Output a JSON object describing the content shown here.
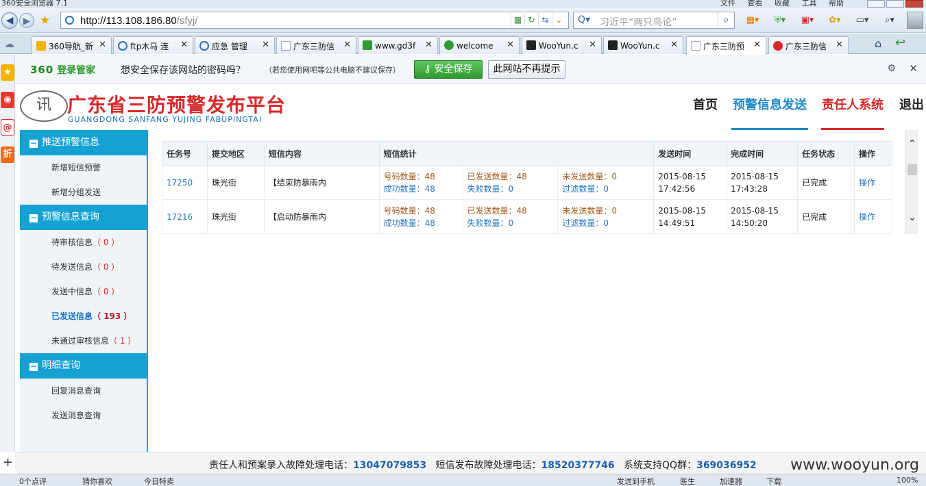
{
  "browser": {
    "title": "360安全浏览器 7.1",
    "menus": [
      "文件",
      "查看",
      "收藏",
      "工具",
      "帮助"
    ],
    "url_host": "http://113.108.186.80",
    "url_path": "/sfyj/",
    "search_text": "习近平“两只鸟论”",
    "tabs": [
      {
        "label": "360导航_新",
        "color": "#f2b400"
      },
      {
        "label": "ftp木马 连",
        "color": "#2f6fb8"
      },
      {
        "label": "应急 管理",
        "color": "#2f6fb8"
      },
      {
        "label": "广东三防信",
        "color": "#9aa7b8"
      },
      {
        "label": "www.gd3f",
        "color": "#2f9a2f"
      },
      {
        "label": "welcome",
        "color": "#2f9a2f"
      },
      {
        "label": "WooYun.c",
        "color": "#222222"
      },
      {
        "label": "WooYun.c",
        "color": "#222222"
      },
      {
        "label": "广东三防预",
        "color": "#9aa7b8"
      },
      {
        "label": "广东三防信",
        "color": "#d8282a"
      }
    ],
    "active_tab": 8
  },
  "password_bar": {
    "brand_num": "360",
    "brand_text": "登录管家",
    "question": "想安全保存该网站的密码吗？",
    "note": "（若您使用网吧等公共电脑不建议保存）",
    "save_label": "安全保存",
    "never_label": "此网站不再提示"
  },
  "site": {
    "emblem_text": "讯",
    "title": "广东省三防预警发布平台",
    "subtitle": "GUANGDONG SANFANG YUJING FABUPINGTAI",
    "nav": {
      "home": "首页",
      "send": "预警信息发送",
      "resp": "责任人系统",
      "logout": "退出"
    }
  },
  "sidebar": {
    "sections": [
      {
        "title": "推送预警信息",
        "items": [
          {
            "label": "新增短信预警",
            "count": ""
          },
          {
            "label": "新增分组发送",
            "count": ""
          }
        ]
      },
      {
        "title": "预警信息查询",
        "items": [
          {
            "label": "待审核信息",
            "count": "（ 0 ）"
          },
          {
            "label": "待发送信息",
            "count": "（ 0 ）"
          },
          {
            "label": "发送中信息",
            "count": "（ 0 ）"
          },
          {
            "label": "已发送信息",
            "count": "（ 193 ）"
          },
          {
            "label": "未通过审核信息",
            "count": "（ 1 ）"
          }
        ]
      },
      {
        "title": "明细查询",
        "items": [
          {
            "label": "回复消息查询",
            "count": ""
          },
          {
            "label": "发送消息查询",
            "count": ""
          }
        ]
      }
    ]
  },
  "table": {
    "headers": [
      "任务号",
      "提交地区",
      "短信内容",
      "短信统计",
      "",
      "",
      "发送时间",
      "完成时间",
      "任务状态",
      "操作"
    ],
    "stat_labels": {
      "numbers": "号码数量：",
      "sent": "已发送数量：",
      "unsent": "未发送数量：",
      "success": "成功数量：",
      "failed": "失败数量：",
      "filtered": "过滤数量："
    },
    "rows": [
      {
        "id": "17250",
        "region": "珠光街",
        "content": "【结束防暴雨内",
        "numbers": "48",
        "sent": "48",
        "unsent": "0",
        "success": "48",
        "failed": "0",
        "filtered": "0",
        "send_date": "2015-08-15",
        "send_time": "17:42:56",
        "done_date": "2015-08-15",
        "done_time": "17:43:28",
        "status": "已完成",
        "action": "操作"
      },
      {
        "id": "17216",
        "region": "珠光街",
        "content": "【启动防暴雨内",
        "numbers": "48",
        "sent": "48",
        "unsent": "0",
        "success": "48",
        "failed": "0",
        "filtered": "0",
        "send_date": "2015-08-15",
        "send_time": "14:49:51",
        "done_date": "2015-08-15",
        "done_time": "14:50:20",
        "status": "已完成",
        "action": "操作"
      }
    ]
  },
  "footer": {
    "label1": "责任人和预案录入故障处理电话：",
    "phone1": "13047079853",
    "label2": "短信发布故障处理电话：",
    "phone2": "18520377746",
    "label3": "系统支持QQ群：",
    "qq": "369036952",
    "watermark": "www.wooyun.org"
  },
  "statusbar": {
    "comments": "0个点评",
    "guess": "猜你喜欢",
    "today": "今日特卖",
    "phone": "发送到手机",
    "doctor": "医生",
    "speed": "加速器",
    "download": "下载",
    "zoom": "100%"
  }
}
